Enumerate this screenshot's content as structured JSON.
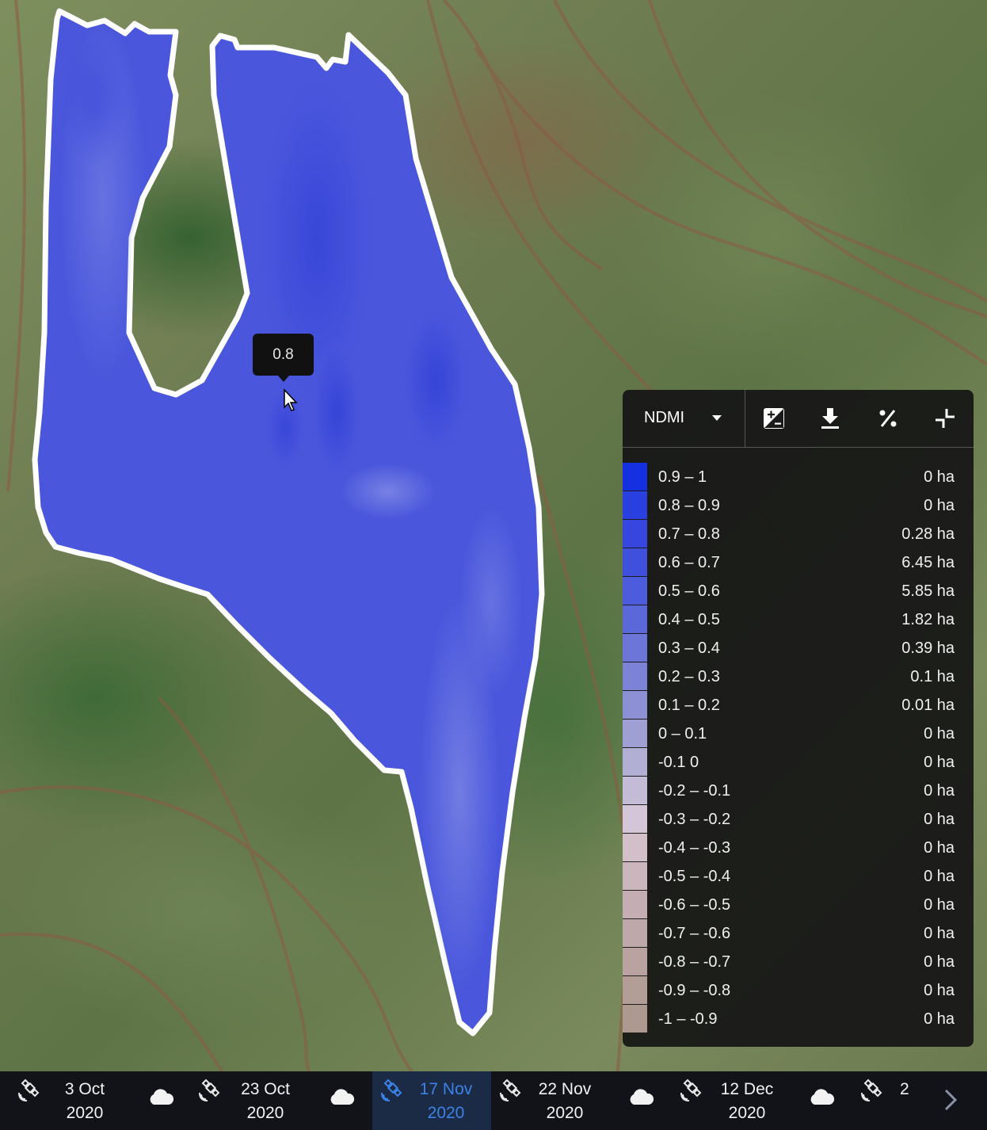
{
  "map": {
    "tooltip_value": "0.8",
    "field_color": "#4a55dc",
    "field_outline": "#ffffff"
  },
  "panel": {
    "index_select": {
      "label": "NDMI"
    },
    "icons": [
      "image-adjust-icon",
      "download-icon",
      "percent-icon",
      "collapse-icon"
    ],
    "legend": [
      {
        "range": "0.9 – 1",
        "area": "0 ha",
        "color": "#1530e0"
      },
      {
        "range": "0.8 – 0.9",
        "area": "0 ha",
        "color": "#2a3fe0"
      },
      {
        "range": "0.7 – 0.8",
        "area": "0.28 ha",
        "color": "#3646de"
      },
      {
        "range": "0.6 – 0.7",
        "area": "6.45 ha",
        "color": "#3f50dd"
      },
      {
        "range": "0.5 – 0.6",
        "area": "5.85 ha",
        "color": "#4c5cdc"
      },
      {
        "range": "0.4 – 0.5",
        "area": "1.82 ha",
        "color": "#5a68da"
      },
      {
        "range": "0.3 – 0.4",
        "area": "0.39 ha",
        "color": "#6b76d8"
      },
      {
        "range": "0.2 – 0.3",
        "area": "0.1 ha",
        "color": "#7c83d6"
      },
      {
        "range": "0.1 – 0.2",
        "area": "0.01 ha",
        "color": "#8d90d4"
      },
      {
        "range": "0 – 0.1",
        "area": "0 ha",
        "color": "#9f9fd3"
      },
      {
        "range": "-0.1 0",
        "area": "0 ha",
        "color": "#b2afd5"
      },
      {
        "range": "-0.2 – -0.1",
        "area": "0 ha",
        "color": "#c4bcd7"
      },
      {
        "range": "-0.3 – -0.2",
        "area": "0 ha",
        "color": "#d4c5d8"
      },
      {
        "range": "-0.4 – -0.3",
        "area": "0 ha",
        "color": "#d2bfc8"
      },
      {
        "range": "-0.5 – -0.4",
        "area": "0 ha",
        "color": "#cbb6bd"
      },
      {
        "range": "-0.6 – -0.5",
        "area": "0 ha",
        "color": "#c5aeb3"
      },
      {
        "range": "-0.7 – -0.6",
        "area": "0 ha",
        "color": "#bfa8a9"
      },
      {
        "range": "-0.8 – -0.7",
        "area": "0 ha",
        "color": "#b9a29f"
      },
      {
        "range": "-0.9 – -0.8",
        "area": "0 ha",
        "color": "#b39d97"
      },
      {
        "range": "-1 – -0.9",
        "area": "0 ha",
        "color": "#ad998f"
      }
    ]
  },
  "timeline": {
    "items": [
      {
        "date": "3 Oct",
        "year": "2020"
      },
      {
        "date": "23 Oct",
        "year": "2020"
      },
      {
        "date": "17 Nov",
        "year": "2020",
        "active": true
      },
      {
        "date": "22 Nov",
        "year": "2020"
      },
      {
        "date": "12 Dec",
        "year": "2020"
      },
      {
        "date": "2",
        "year": ""
      }
    ],
    "accent_color": "#3b82e6"
  }
}
